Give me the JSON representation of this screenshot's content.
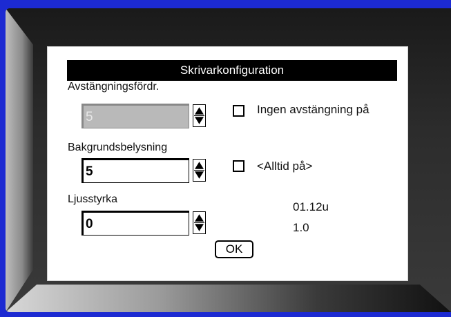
{
  "dialog": {
    "title": "Skrivarkonfiguration"
  },
  "shutdown": {
    "label": "Avstängningsfördr.",
    "value": "5",
    "checkbox_label": "Ingen avstängning på",
    "checked": false
  },
  "backlight": {
    "label": "Bakgrundsbelysning",
    "value": "5",
    "checkbox_label": "<Alltid på>",
    "checked": false
  },
  "brightness": {
    "label": "Ljusstyrka",
    "value": "0"
  },
  "versions": {
    "firmware": "01.12u",
    "hardware": "1.0"
  },
  "buttons": {
    "ok_label": "OK"
  }
}
